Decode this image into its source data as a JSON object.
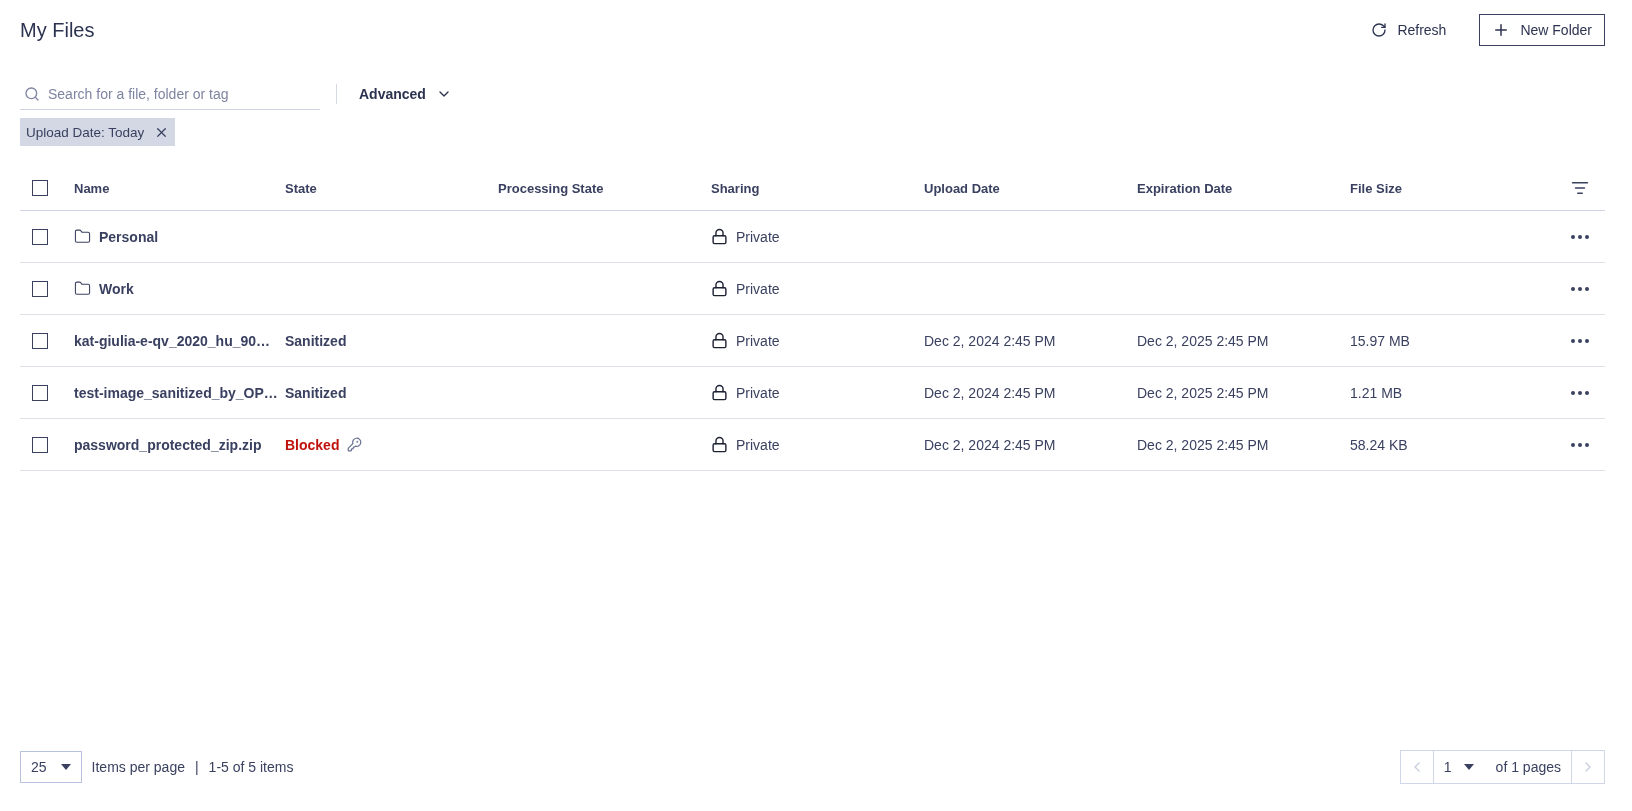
{
  "title": "My Files",
  "actions": [
    {
      "kind": "refresh",
      "label": "Refresh"
    },
    {
      "kind": "new-folder",
      "label": "New Folder"
    }
  ],
  "search": {
    "placeholder": "Search for a file, folder or tag"
  },
  "advanced": {
    "label": "Advanced"
  },
  "filters": [
    {
      "label": "Upload Date: Today"
    }
  ],
  "table": {
    "select_all": {
      "checked": false
    },
    "columns": [
      "Name",
      "State",
      "Processing State",
      "Sharing",
      "Upload Date",
      "Expiration Date",
      "File Size"
    ],
    "rows": [
      {
        "checked": false,
        "kind": "folder",
        "name": "Personal",
        "sharing": "Private"
      },
      {
        "checked": false,
        "kind": "folder",
        "name": "Work",
        "sharing": "Private"
      },
      {
        "checked": false,
        "kind": "file",
        "name": "kat-giulia-e-qv_2020_hu_90…",
        "state": {
          "label": "Sanitized",
          "kind": "sanitized"
        },
        "sharing": "Private",
        "upload_date": "Dec 2, 2024 2:45 PM",
        "expiration_date": "Dec 2, 2025 2:45 PM",
        "size": "15.97 MB"
      },
      {
        "checked": false,
        "kind": "file",
        "name": "test-image_sanitized_by_OP…",
        "state": {
          "label": "Sanitized",
          "kind": "sanitized"
        },
        "sharing": "Private",
        "upload_date": "Dec 2, 2024 2:45 PM",
        "expiration_date": "Dec 2, 2025 2:45 PM",
        "size": "1.21 MB"
      },
      {
        "checked": false,
        "kind": "file",
        "name": "password_protected_zip.zip",
        "state": {
          "label": "Blocked",
          "kind": "blocked"
        },
        "sharing": "Private",
        "upload_date": "Dec 2, 2024 2:45 PM",
        "expiration_date": "Dec 2, 2025 2:45 PM",
        "size": "58.24 KB"
      }
    ]
  },
  "footer": {
    "page_size": "25",
    "page_size_label": "Items per page",
    "separator": "|",
    "range": "1-5 of 5 items",
    "page": "1",
    "pages_label": "of 1 pages",
    "prev_disabled": true,
    "next_disabled": true
  }
}
